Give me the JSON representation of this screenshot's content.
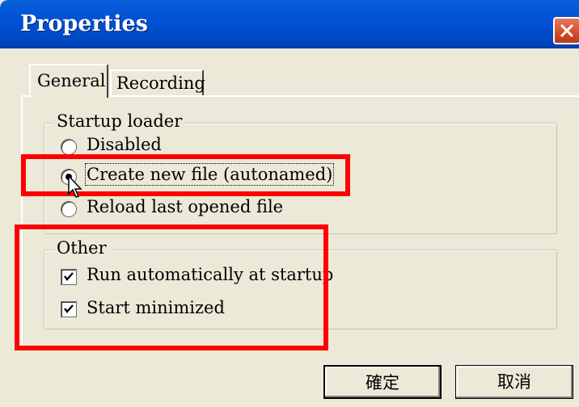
{
  "window": {
    "title": "Properties"
  },
  "tabs": [
    {
      "label": "General",
      "selected": true
    },
    {
      "label": "Recording",
      "selected": false
    }
  ],
  "startup_loader": {
    "legend": "Startup loader",
    "options": [
      {
        "label": "Disabled",
        "selected": false
      },
      {
        "label": "Create new file (autonamed)",
        "selected": true
      },
      {
        "label": "Reload last opened file",
        "selected": false
      }
    ]
  },
  "other": {
    "legend": "Other",
    "options": [
      {
        "label": "Run automatically at startup",
        "checked": true
      },
      {
        "label": "Start minimized",
        "checked": true
      }
    ]
  },
  "buttons": {
    "ok": "確定",
    "cancel": "取消"
  },
  "colors": {
    "titlebar": "#0052d6",
    "highlight": "#ff0000",
    "dialog_bg": "#ece9d8"
  },
  "icons": {
    "close": "close-icon",
    "cursor": "mouse-pointer-icon"
  }
}
